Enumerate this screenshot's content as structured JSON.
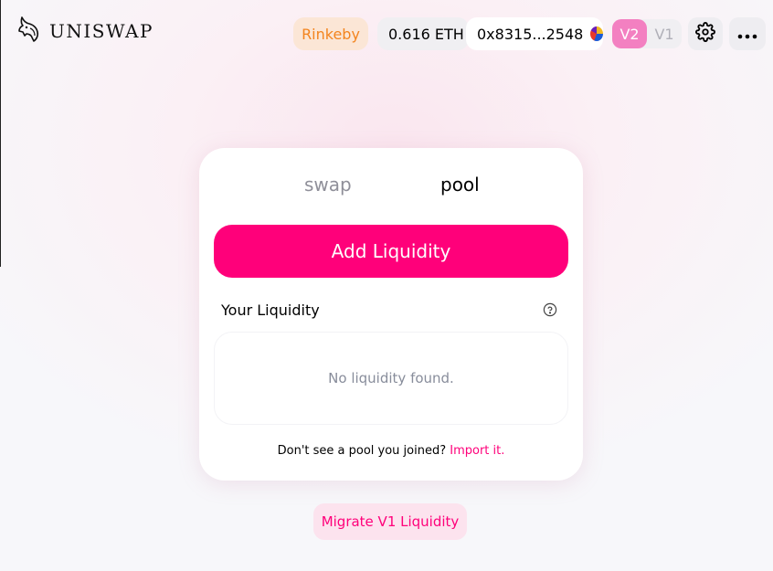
{
  "header": {
    "brand": "UNISWAP",
    "network": "Rinkeby",
    "balance": "0.616 ETH",
    "account": "0x8315...2548",
    "versions": [
      "V2",
      "V1"
    ],
    "active_version": "V2"
  },
  "icons": {
    "logo": "unicorn-icon",
    "account": "identicon-icon",
    "settings": "gear-icon",
    "more": "more-dots-icon",
    "help": "question-icon"
  },
  "card": {
    "tabs": [
      "swap",
      "pool"
    ],
    "active_tab": "pool",
    "add_liquidity_label": "Add Liquidity",
    "your_liquidity_label": "Your Liquidity",
    "empty_text": "No liquidity found.",
    "import_prompt": "Don't see a pool you joined?",
    "import_link": "Import it."
  },
  "migrate_label": "Migrate V1 Liquidity",
  "colors": {
    "accent": "#ff007a",
    "network": "#f3841e",
    "version_active": "#f380c1"
  }
}
